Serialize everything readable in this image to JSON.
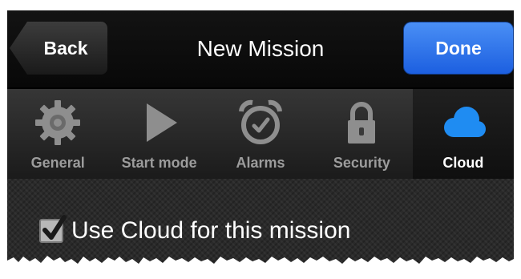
{
  "navbar": {
    "back_label": "Back",
    "title": "New Mission",
    "done_label": "Done"
  },
  "tabs": [
    {
      "label": "General",
      "icon": "gear-icon",
      "selected": false
    },
    {
      "label": "Start mode",
      "icon": "play-icon",
      "selected": false
    },
    {
      "label": "Alarms",
      "icon": "alarm-clock-icon",
      "selected": false
    },
    {
      "label": "Security",
      "icon": "lock-icon",
      "selected": false
    },
    {
      "label": "Cloud",
      "icon": "cloud-icon",
      "selected": true
    }
  ],
  "content": {
    "cloud_option_label": "Use Cloud for this mission",
    "cloud_option_checked": true
  },
  "colors": {
    "done_blue": "#1c5fe0",
    "cloud_blue": "#1f8cf2",
    "icon_gray": "#8e8e8e"
  }
}
